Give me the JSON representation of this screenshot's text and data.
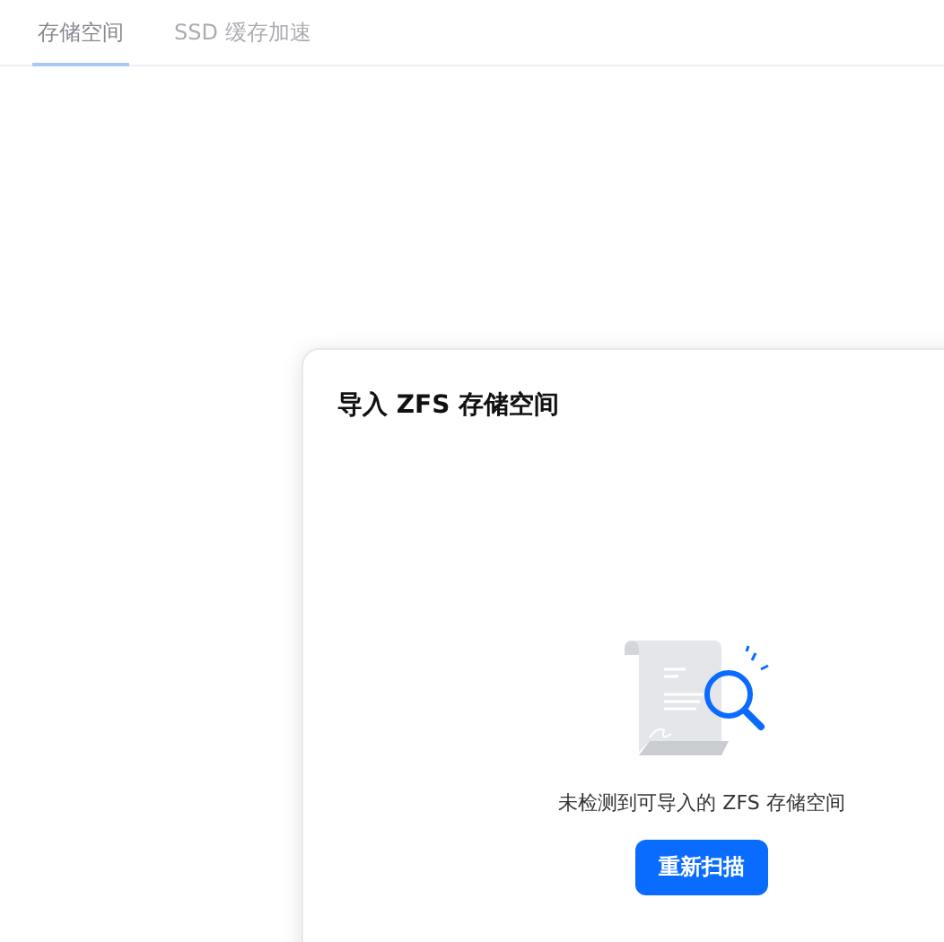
{
  "tabs": [
    {
      "label": "存储空间",
      "selected": true
    },
    {
      "label": "SSD 缓存加速",
      "selected": false
    }
  ],
  "dialog": {
    "title": "导入 ZFS 存储空间",
    "empty_message": "未检测到可导入的 ZFS 存储空间",
    "button": "重新扫描"
  }
}
